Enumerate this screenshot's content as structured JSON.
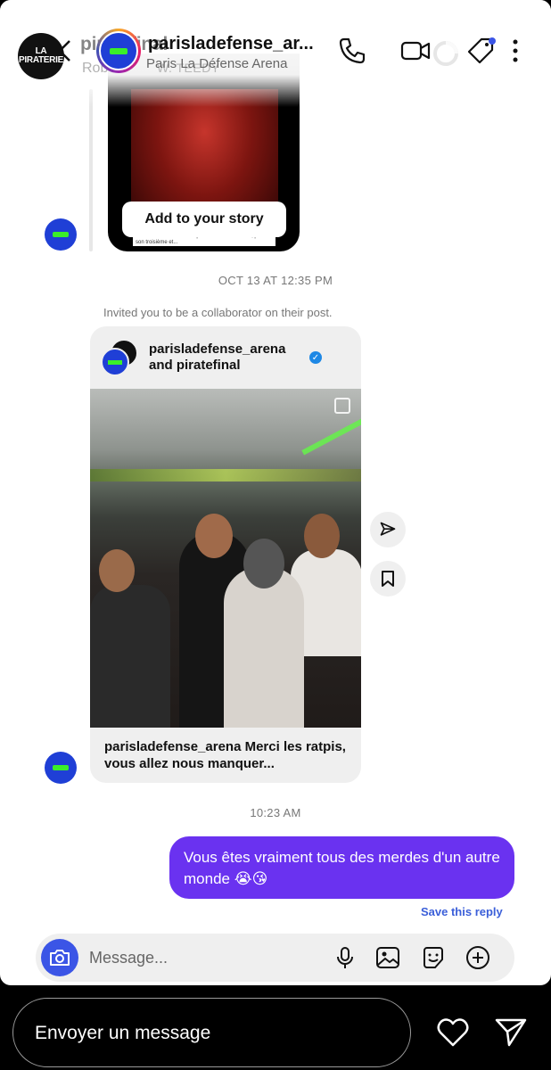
{
  "header": {
    "badge_text": "LA PIRATERIE",
    "overlay_title": "piratefinal",
    "title": "parisladefense_ar...",
    "overlay_subtitle": "Rob49",
    "subtitle": "Paris La Défense Arena",
    "music_tag": "W. TEEDY"
  },
  "shared_story": {
    "caption": "parisladefense_arena Hier soir, Booba a plié le game à Paris La Défense Arena après 31 ans de carrière, pour son troisième et...",
    "add_to_story_label": "Add to your story"
  },
  "thread": {
    "timestamp_1": "OCT 13 AT 12:35 PM",
    "invite_note": "Invited you to be a collaborator on their post.",
    "post": {
      "author_line1": "parisladefense_arena",
      "author_line2": "and piratefinal",
      "caption": "parisladefense_arena Merci les ratpis, vous allez nous manquer..."
    },
    "timestamp_2": "10:23 AM",
    "my_message": "Vous êtes vraiment tous des merdes d'un autre monde 😭😘",
    "save_reply_label": "Save this reply"
  },
  "composer": {
    "placeholder": "Message..."
  },
  "story_reply": {
    "placeholder": "Envoyer un message"
  },
  "colors": {
    "bubble": "#6a32f0",
    "accent_blue": "#3b55e6",
    "verified": "#1e88e5",
    "avatar_bg": "#1f3fd6",
    "avatar_mark": "#3aef2a"
  }
}
